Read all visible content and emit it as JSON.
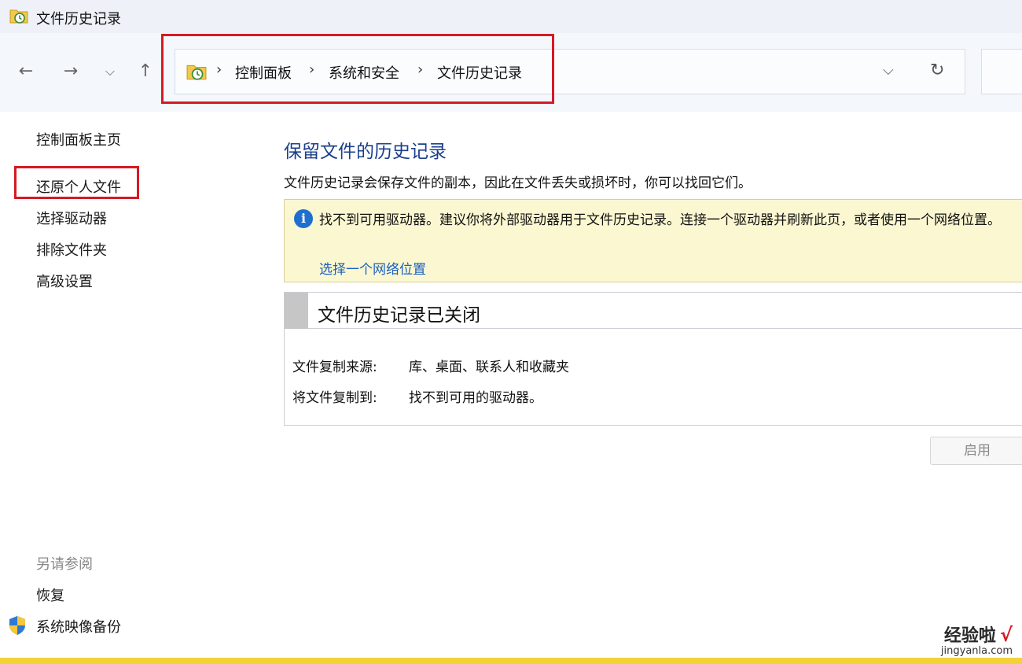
{
  "window": {
    "title": "文件历史记录"
  },
  "nav": {
    "back": "←",
    "forward": "→",
    "recent": "⌵",
    "up": "↑"
  },
  "address": {
    "crumbs": [
      "控制面板",
      "系统和安全",
      "文件历史记录"
    ],
    "separator": "›",
    "dropdown": "⌵",
    "refresh": "↻"
  },
  "sidebar": {
    "home": "控制面板主页",
    "items": [
      "还原个人文件",
      "选择驱动器",
      "排除文件夹",
      "高级设置"
    ],
    "see_also_label": "另请参阅",
    "see_also": [
      "恢复",
      "系统映像备份"
    ]
  },
  "main": {
    "heading": "保留文件的历史记录",
    "intro": "文件历史记录会保存文件的副本，因此在文件丢失或损坏时，你可以找回它们。",
    "warning": {
      "icon": "i",
      "text": "找不到可用驱动器。建议你将外部驱动器用于文件历史记录。连接一个驱动器并刷新此页，或者使用一个网络位置。",
      "link": "选择一个网络位置"
    },
    "status": {
      "title": "文件历史记录已关闭",
      "rows": [
        {
          "label": "文件复制来源:",
          "value": "库、桌面、联系人和收藏夹"
        },
        {
          "label": "将文件复制到:",
          "value": "找不到可用的驱动器。"
        }
      ]
    },
    "enable_button": "启用"
  },
  "watermark": {
    "main": "经验啦",
    "check": "√",
    "sub": "jingyanla.com"
  },
  "colors": {
    "heading_blue": "#1c3f8c",
    "link_blue": "#1a5fc0",
    "highlight_red": "#d51a24",
    "warning_bg": "#fbf7d1",
    "bottom_strip": "#f1d336"
  }
}
